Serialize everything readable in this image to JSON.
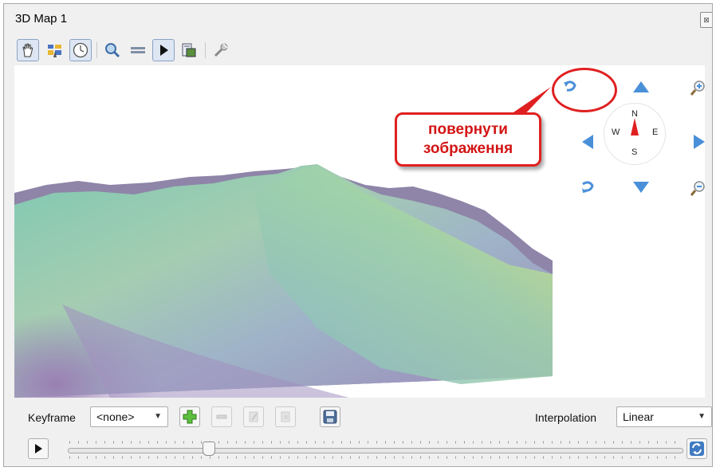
{
  "window": {
    "title": "3D Map 1",
    "close_glyph": "⊠"
  },
  "toolbar": {
    "tools": [
      {
        "name": "pan-hand-icon",
        "active": true
      },
      {
        "name": "identify-tool-icon",
        "active": false
      },
      {
        "name": "camera-control-icon",
        "active": true
      },
      {
        "name": "zoom-magnifier-icon",
        "active": false
      },
      {
        "name": "measure-line-icon",
        "active": false
      },
      {
        "name": "animation-play-icon",
        "active": true
      },
      {
        "name": "export-image-icon",
        "active": false
      },
      {
        "name": "settings-wrench-icon",
        "active": false
      }
    ]
  },
  "navigation": {
    "compass": {
      "north": "N",
      "south": "S",
      "east": "E",
      "west": "W"
    }
  },
  "annotation": {
    "line1": "повернути",
    "line2": "зображення",
    "color": "#e02020"
  },
  "keyframe": {
    "label": "Keyframe",
    "value": "<none>",
    "interpolation_label": "Interpolation",
    "interpolation_value": "Linear"
  },
  "timeline": {
    "position_fraction": 0.23
  },
  "colors": {
    "accent": "#4a90d9",
    "annotation_red": "#e02020"
  }
}
